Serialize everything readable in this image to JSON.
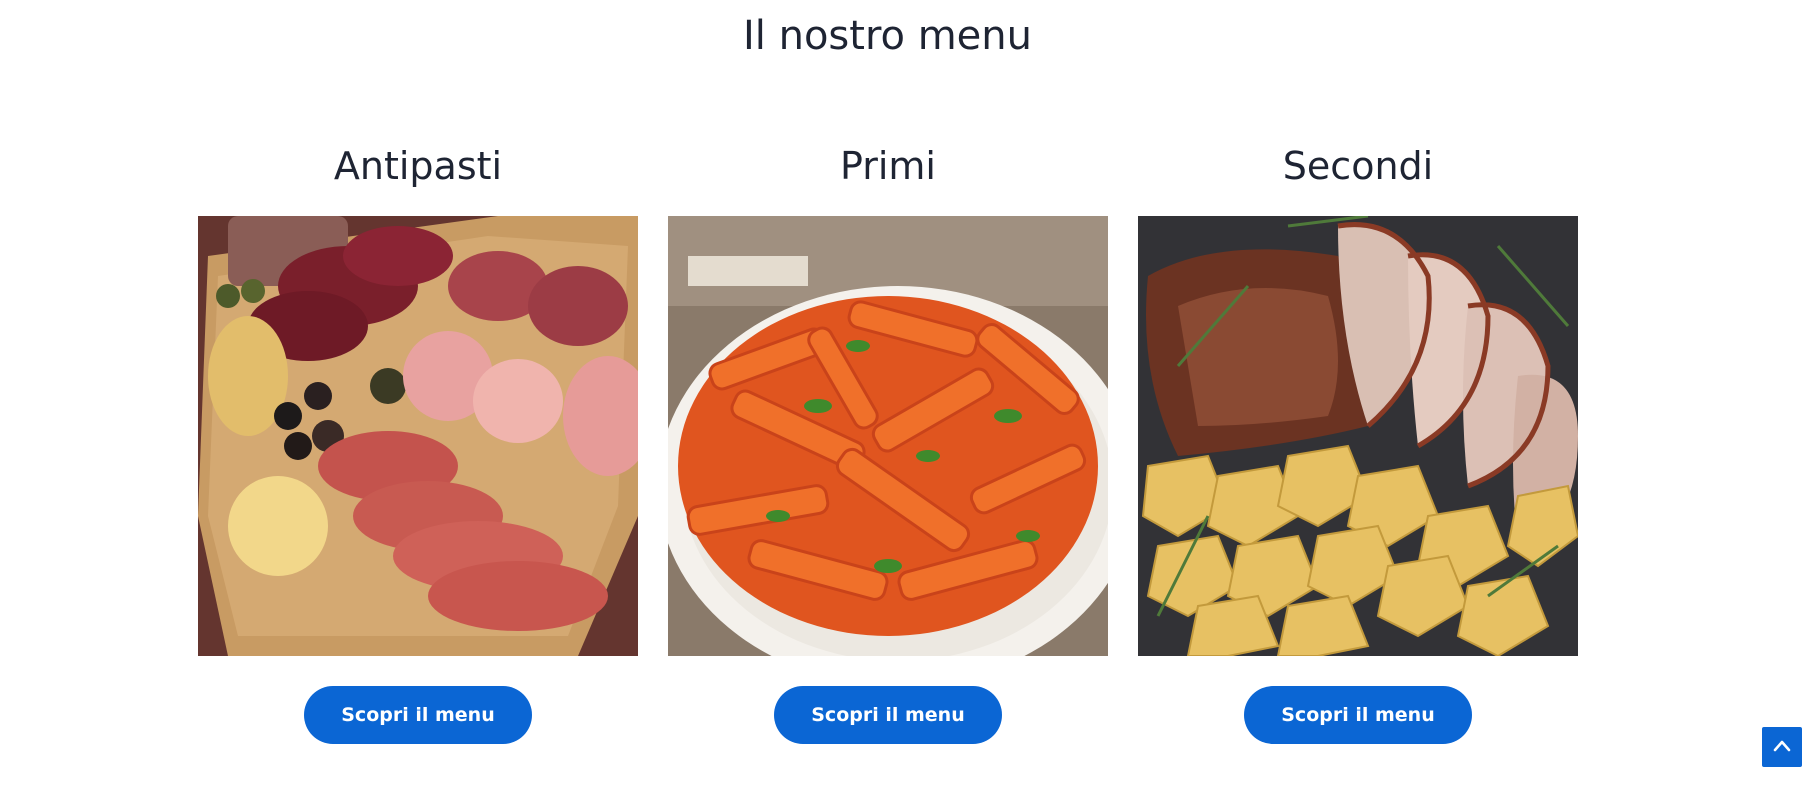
{
  "page": {
    "title": "Il nostro menu"
  },
  "cards": [
    {
      "title": "Antipasti",
      "button_label": "Scopri il menu",
      "image_icon": "charcuterie-board-image"
    },
    {
      "title": "Primi",
      "button_label": "Scopri il menu",
      "image_icon": "penne-pasta-image"
    },
    {
      "title": "Secondi",
      "button_label": "Scopri il menu",
      "image_icon": "roast-pork-potatoes-image"
    }
  ],
  "back_to_top": {
    "icon": "chevron-up-icon"
  },
  "colors": {
    "accent": "#0b66d4",
    "heading": "#1e2433",
    "background": "#ffffff"
  }
}
